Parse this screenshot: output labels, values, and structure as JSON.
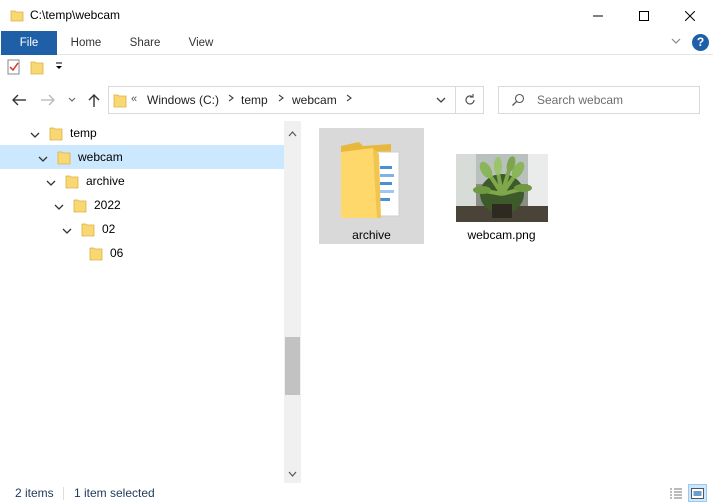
{
  "window": {
    "title": "C:\\temp\\webcam"
  },
  "ribbon": {
    "tabs": [
      "File",
      "Home",
      "Share",
      "View"
    ],
    "help": "?"
  },
  "address": {
    "overflow": "«",
    "crumbs": [
      "Windows (C:)",
      "temp",
      "webcam"
    ]
  },
  "search": {
    "placeholder": "Search webcam"
  },
  "tree": [
    {
      "label": "temp",
      "level": 0,
      "expanded": true,
      "selected": false
    },
    {
      "label": "webcam",
      "level": 1,
      "expanded": true,
      "selected": true
    },
    {
      "label": "archive",
      "level": 2,
      "expanded": true,
      "selected": false
    },
    {
      "label": "2022",
      "level": 3,
      "expanded": true,
      "selected": false
    },
    {
      "label": "02",
      "level": 4,
      "expanded": true,
      "selected": false
    },
    {
      "label": "06",
      "level": 5,
      "expanded": false,
      "selected": false
    }
  ],
  "files": [
    {
      "name": "archive",
      "type": "folder",
      "selected": true
    },
    {
      "name": "webcam.png",
      "type": "image",
      "selected": false
    }
  ],
  "status": {
    "count": "2 items",
    "selection": "1 item selected"
  },
  "colors": {
    "accent": "#1f5fa8",
    "selection": "#cce8ff",
    "folder": "#ffd86b"
  }
}
